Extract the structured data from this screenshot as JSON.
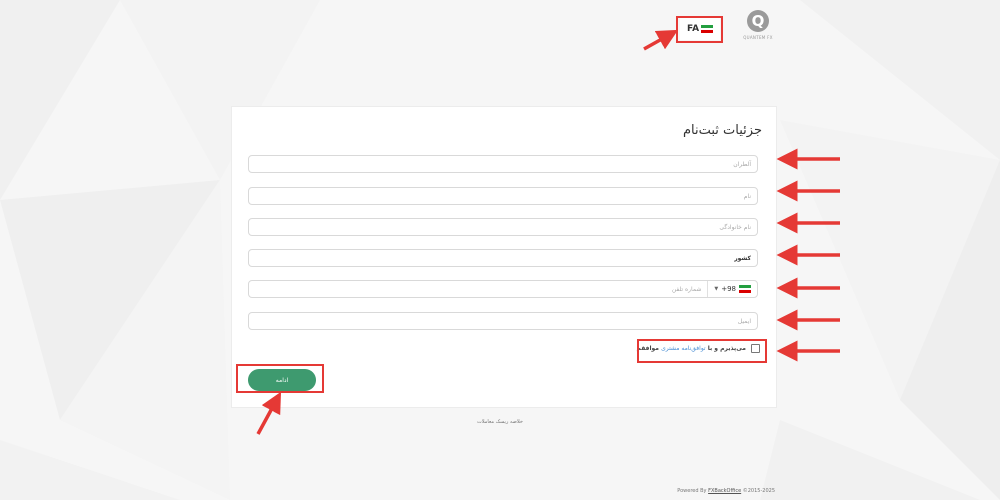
{
  "header": {
    "lang_label": "FA",
    "logo_letter": "Q",
    "logo_text": "QUANTEM FX"
  },
  "form": {
    "title": "جزئیات ثبت‌نام",
    "fields": [
      {
        "placeholder": "آلطران",
        "value": ""
      },
      {
        "placeholder": "نام",
        "value": ""
      },
      {
        "placeholder": "نام خانوادگی",
        "value": ""
      },
      {
        "placeholder": "",
        "value": "کشور"
      },
      {
        "placeholder": "شماره تلفن",
        "value": ""
      },
      {
        "placeholder": "ایمیل",
        "value": ""
      }
    ],
    "phone_code": "+98",
    "terms_prefix": "می‌پذیرم و با ",
    "terms_link": "توافق‌نامه مشتری",
    "terms_suffix": " موافقم",
    "submit_label": "ادامه"
  },
  "summary_link": "خلاصه ریسک معاملات",
  "footer": {
    "prefix": "Powered By ",
    "brand": "FXBackOffice",
    "suffix": " ©2015-2025"
  },
  "colors": {
    "accent": "#3e9a6f",
    "annotation": "#e53935",
    "link": "#4a8fd4",
    "flag_green": "#239f40",
    "flag_white": "#ffffff",
    "flag_red": "#da0000"
  }
}
